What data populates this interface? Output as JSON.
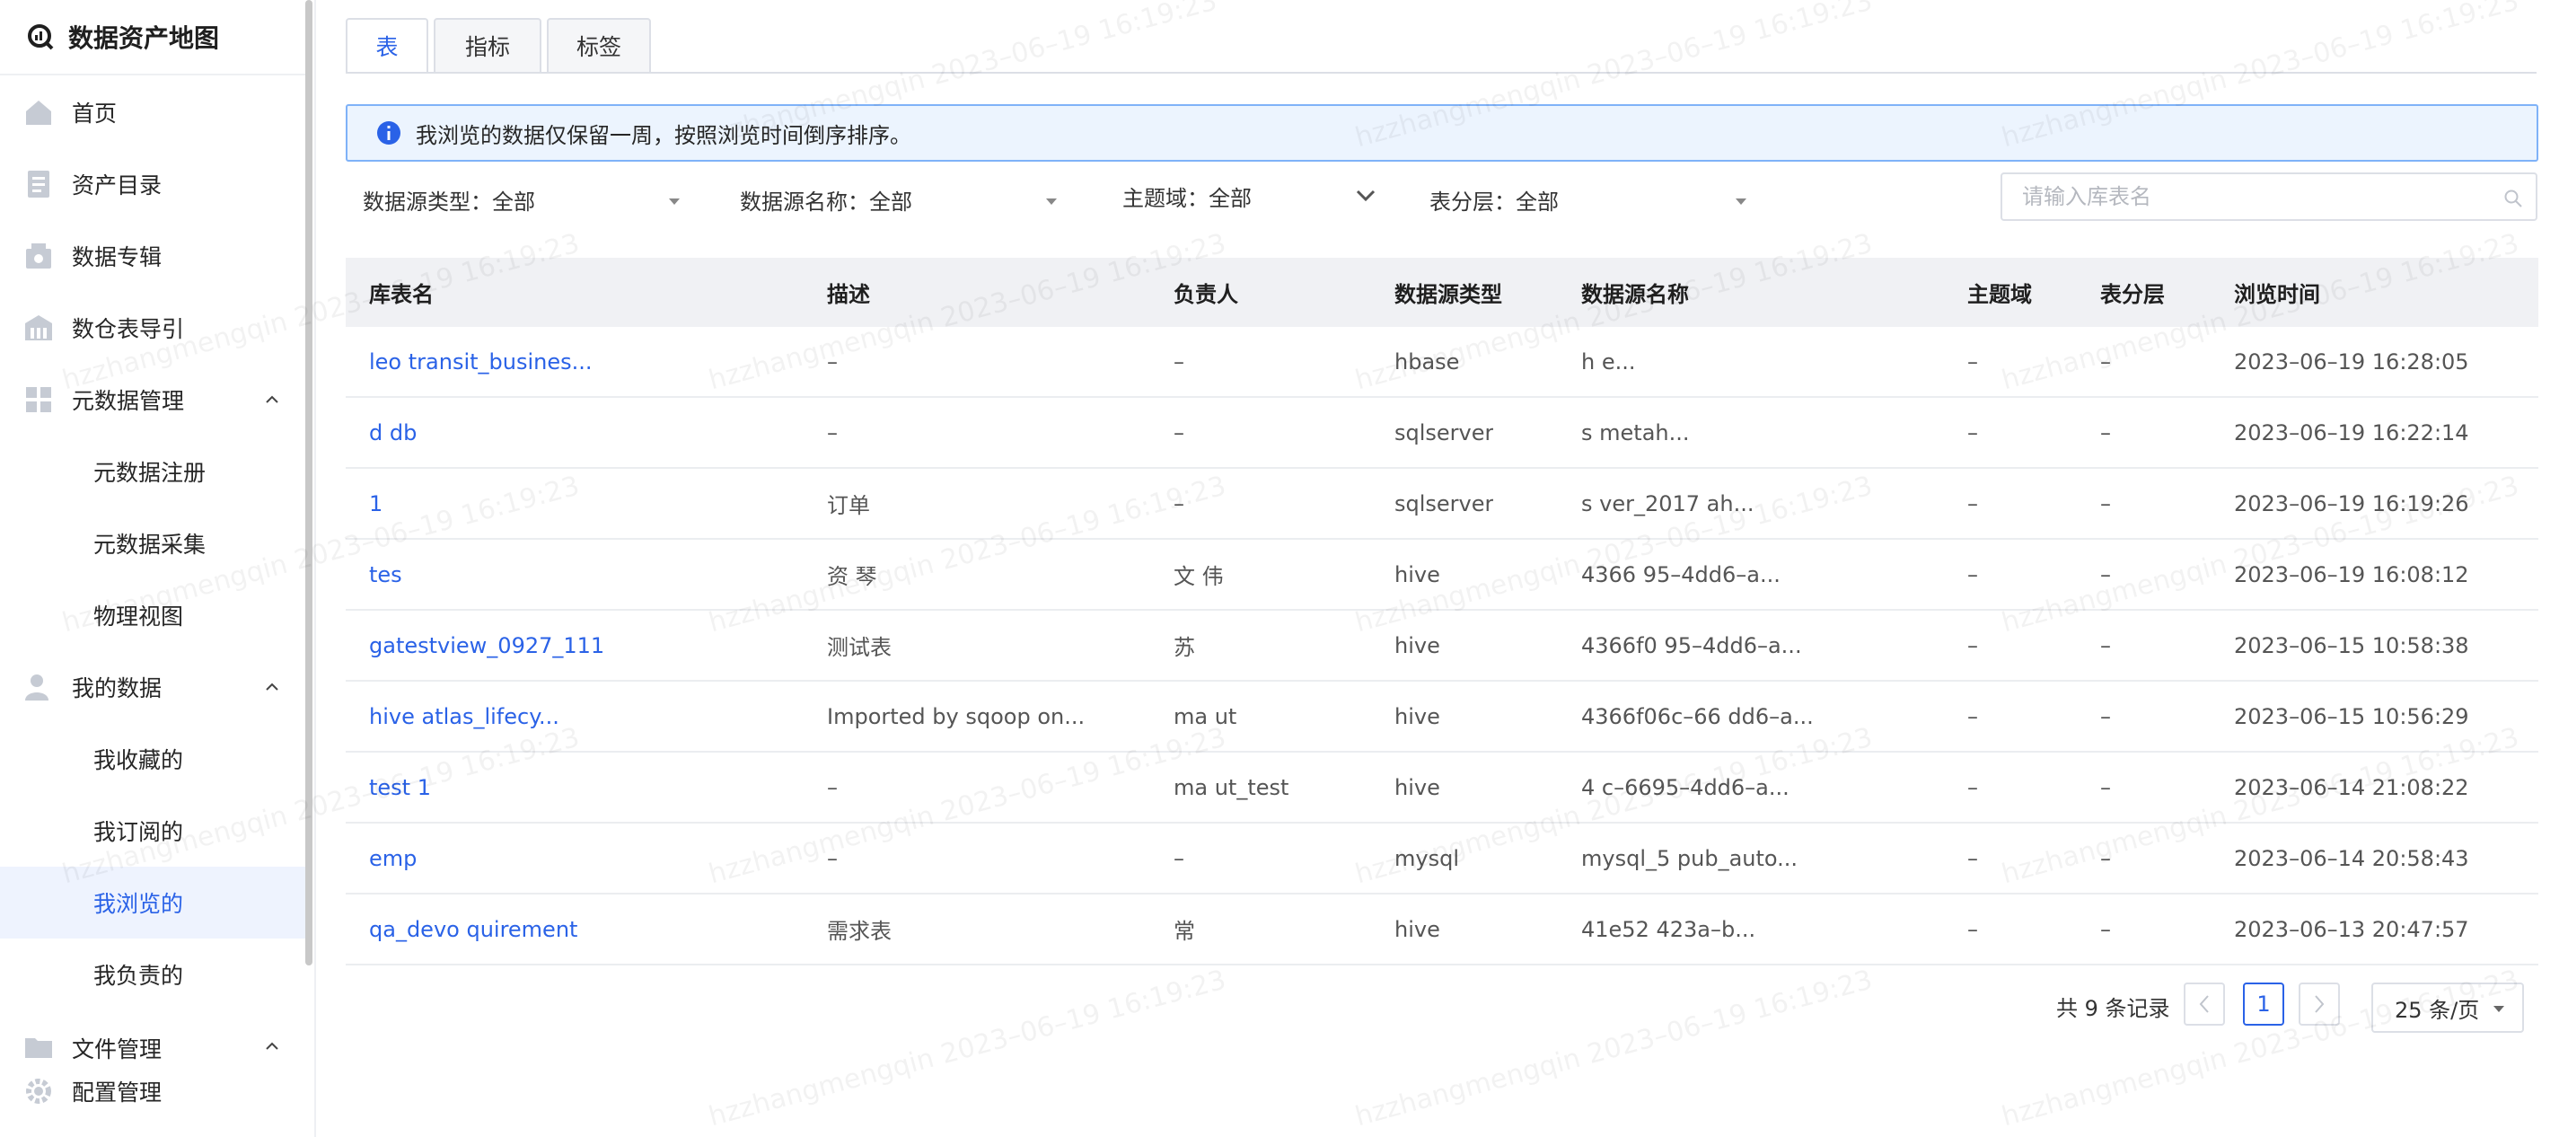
{
  "sidebar": {
    "app_title": "数据资产地图",
    "items": [
      {
        "label": "首页",
        "icon": "home-icon"
      },
      {
        "label": "资产目录",
        "icon": "catalog-icon"
      },
      {
        "label": "数据专辑",
        "icon": "album-icon"
      },
      {
        "label": "数仓表导引",
        "icon": "warehouse-icon"
      },
      {
        "label": "元数据管理",
        "icon": "metadata-icon"
      },
      {
        "label": "元数据注册"
      },
      {
        "label": "元数据采集"
      },
      {
        "label": "物理视图"
      },
      {
        "label": "我的数据",
        "icon": "user-icon"
      },
      {
        "label": "我收藏的"
      },
      {
        "label": "我订阅的"
      },
      {
        "label": "我浏览的"
      },
      {
        "label": "我负责的"
      },
      {
        "label": "文件管理",
        "icon": "folder-icon"
      },
      {
        "label": "配置管理",
        "icon": "gear-icon"
      }
    ]
  },
  "tabs": [
    "表",
    "指标",
    "标签"
  ],
  "alert": {
    "text": "我浏览的数据仅保留一周，按照浏览时间倒序排序。"
  },
  "filters": {
    "source_type": "数据源类型：全部",
    "source_name": "数据源名称：全部",
    "subject": "主题域：全部",
    "layer": "表分层：全部",
    "search_placeholder": "请输入库表名"
  },
  "table": {
    "headers": [
      "库表名",
      "描述",
      "负责人",
      "数据源类型",
      "数据源名称",
      "主题域",
      "表分层",
      "浏览时间"
    ],
    "rows": [
      {
        "name": "leo transit_busines...",
        "desc": "–",
        "owner": "–",
        "type": "hbase",
        "source": "h e...",
        "subject": "–",
        "layer": "–",
        "time": "2023–06–19 16:28:05"
      },
      {
        "name": "d db",
        "desc": "–",
        "owner": "–",
        "type": "sqlserver",
        "source": "s metah...",
        "subject": "–",
        "layer": "–",
        "time": "2023–06–19 16:22:14"
      },
      {
        "name": "1",
        "desc": "订单",
        "owner": "–",
        "type": "sqlserver",
        "source": "s ver_2017 ah...",
        "subject": "–",
        "layer": "–",
        "time": "2023–06–19 16:19:26"
      },
      {
        "name": "tes",
        "desc": "资 琴",
        "owner": "文 伟",
        "type": "hive",
        "source": "4366 95–4dd6–a...",
        "subject": "–",
        "layer": "–",
        "time": "2023–06–19 16:08:12"
      },
      {
        "name": "gatestview_0927_111",
        "desc": "测试表",
        "owner": "苏",
        "type": "hive",
        "source": "4366f0 95–4dd6–a...",
        "subject": "–",
        "layer": "–",
        "time": "2023–06–15 10:58:38"
      },
      {
        "name": "hive atlas_lifecy...",
        "desc": "Imported by sqoop on...",
        "owner": "ma ut",
        "type": "hive",
        "source": "4366f06c–66 dd6–a...",
        "subject": "–",
        "layer": "–",
        "time": "2023–06–15 10:56:29"
      },
      {
        "name": "test 1",
        "desc": "–",
        "owner": "ma ut_test",
        "type": "hive",
        "source": "4 c–6695–4dd6–a...",
        "subject": "–",
        "layer": "–",
        "time": "2023–06–14 21:08:22"
      },
      {
        "name": "emp",
        "desc": "–",
        "owner": "–",
        "type": "mysql",
        "source": "mysql_5 pub_auto...",
        "subject": "–",
        "layer": "–",
        "time": "2023–06–14 20:58:43"
      },
      {
        "name": "qa_devo quirement",
        "desc": "需求表",
        "owner": "常",
        "type": "hive",
        "source": "41e52 423a–b...",
        "subject": "–",
        "layer": "–",
        "time": "2023–06–13 20:47:57"
      }
    ]
  },
  "pagination": {
    "total": "共 9 条记录",
    "page": "1",
    "page_size": "25 条/页"
  },
  "watermark": "hzzhangmengqin 2023–06–19 16:19:23",
  "colors": {
    "primary": "#2a62e7",
    "alert_bg": "#ecf4fe",
    "header_bg": "#f0f1f4"
  }
}
